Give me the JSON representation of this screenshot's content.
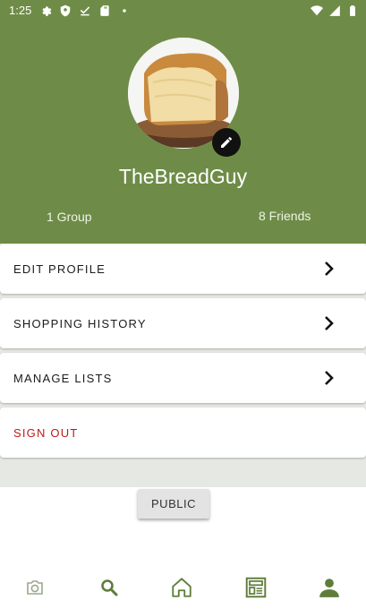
{
  "status_bar": {
    "time": "1:25"
  },
  "profile": {
    "username": "TheBreadGuy",
    "groups": "1 Group",
    "friends": "8 Friends"
  },
  "menu": {
    "items": [
      {
        "label": "EDIT PROFILE"
      },
      {
        "label": "SHOPPING HISTORY"
      },
      {
        "label": "MANAGE LISTS"
      },
      {
        "label": "SIGN OUT"
      }
    ]
  },
  "visibility_button": "PUBLIC",
  "colors": {
    "header": "#6e8c47",
    "nav_active": "#5f7d3a",
    "sign_out": "#c01818"
  },
  "bottom_nav": {
    "items": [
      {
        "icon": "camera-icon"
      },
      {
        "icon": "search-icon"
      },
      {
        "icon": "home-icon"
      },
      {
        "icon": "list-icon"
      },
      {
        "icon": "person-icon",
        "active": true
      }
    ]
  }
}
